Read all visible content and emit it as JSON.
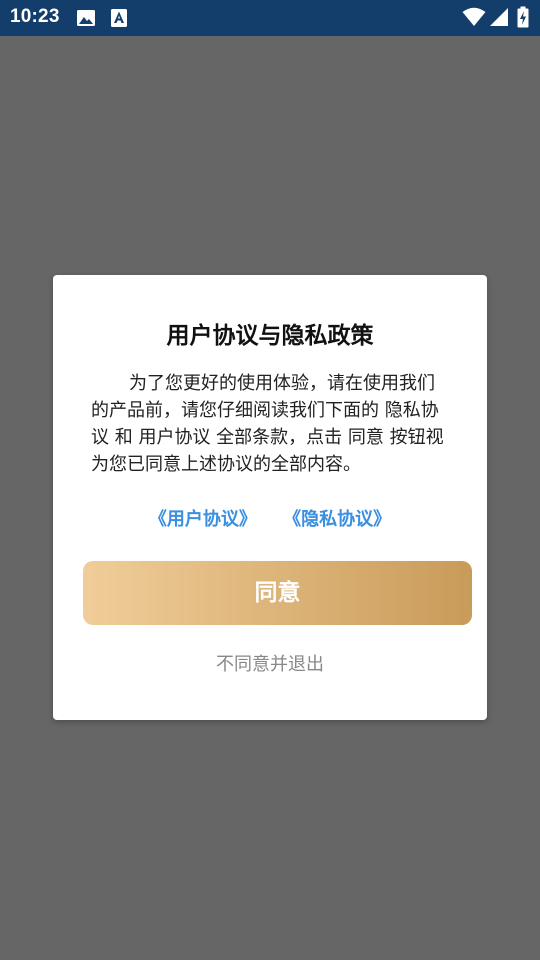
{
  "status_bar": {
    "time": "10:23",
    "icons": [
      "image-icon",
      "font-a-icon",
      "wifi-icon",
      "signal-icon",
      "battery-charging-icon"
    ],
    "background_color": "#133d6b"
  },
  "dialog": {
    "title": "用户协议与隐私政策",
    "body": "为了您更好的使用体验，请在使用我们的产品前，请您仔细阅读我们下面的 隐私协议 和 用户协议 全部条款，点击 同意 按钮视为您已同意上述协议的全部内容。",
    "links": {
      "user_agreement": "《用户协议》",
      "privacy_agreement": "《隐私协议》"
    },
    "agree_label": "同意",
    "decline_label": "不同意并退出",
    "link_color": "#3a8fe0",
    "button_gradient": [
      "#f0cd99",
      "#c99b59"
    ]
  }
}
